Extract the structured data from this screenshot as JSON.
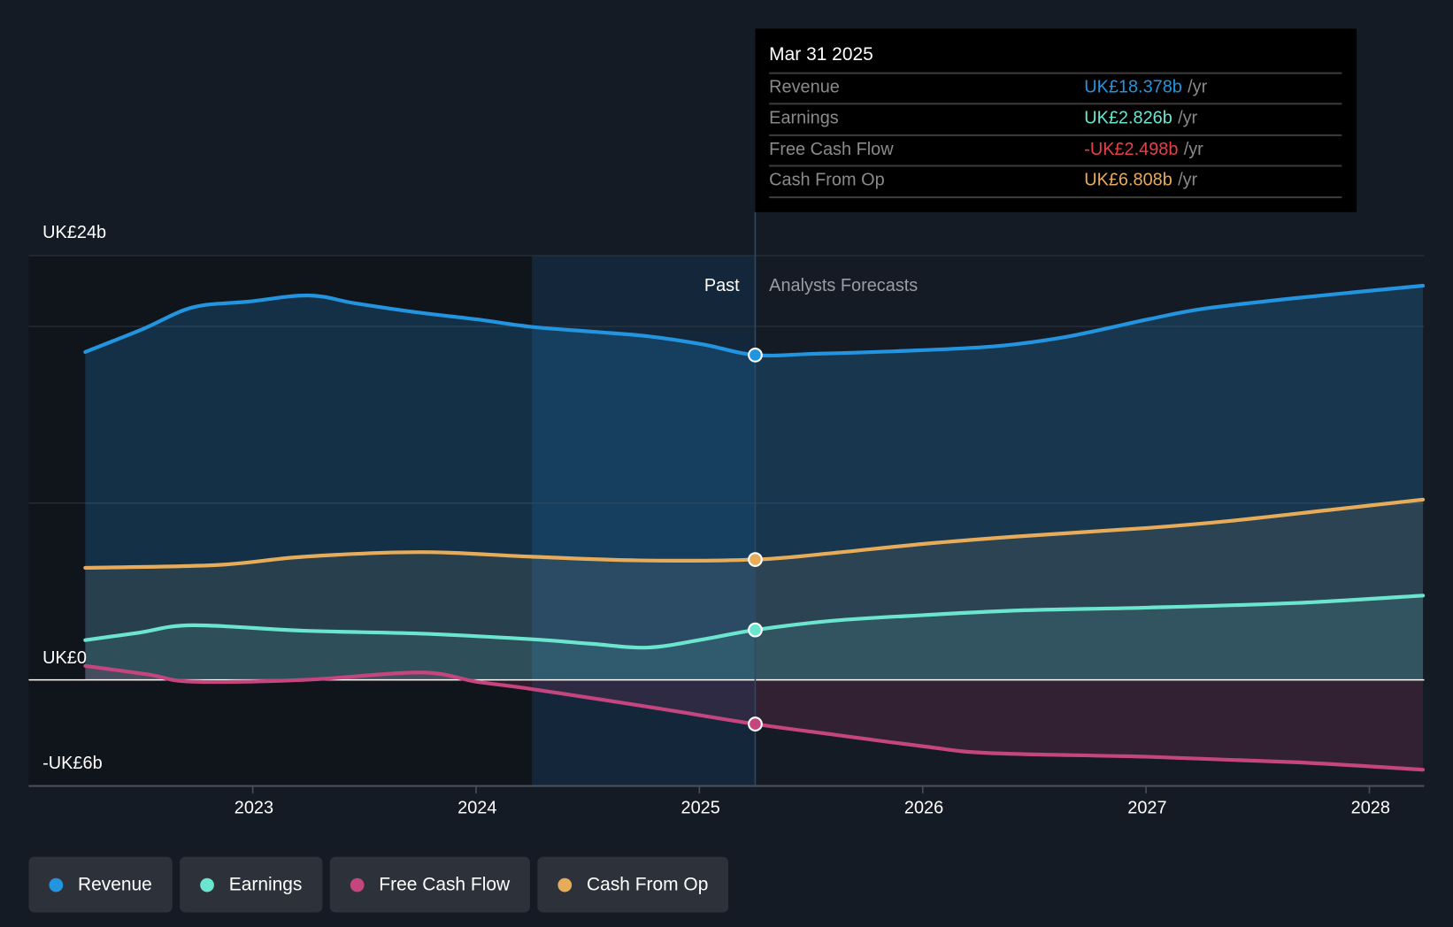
{
  "chart_data": {
    "type": "line",
    "title": "",
    "y_unit": "UKÂ£ billions",
    "ylim": [
      -6,
      24
    ],
    "y_ticks": [
      {
        "value": 24,
        "label": "UK£24b"
      },
      {
        "value": 0,
        "label": "UK£0"
      },
      {
        "value": -6,
        "label": "-UK£6b"
      }
    ],
    "y_gridlines": [
      24,
      20,
      10,
      0
    ],
    "xlim": [
      2022.0,
      2028.24
    ],
    "x_ticks": [
      {
        "value": 2023,
        "label": "2023"
      },
      {
        "value": 2024,
        "label": "2024"
      },
      {
        "value": 2025,
        "label": "2025"
      },
      {
        "value": 2026,
        "label": "2026"
      },
      {
        "value": 2027,
        "label": "2027"
      },
      {
        "value": 2028,
        "label": "2028"
      }
    ],
    "past_label": "Past",
    "forecast_label": "Analysts Forecasts",
    "divider_x": 2025.25,
    "highlight_start_x": 2024.25,
    "series": [
      {
        "name": "Revenue",
        "color": "#2394df",
        "points": [
          [
            2022.25,
            18.55
          ],
          [
            2022.51,
            19.86
          ],
          [
            2022.73,
            21.07
          ],
          [
            2022.98,
            21.4
          ],
          [
            2023.25,
            21.75
          ],
          [
            2023.46,
            21.3
          ],
          [
            2023.73,
            20.8
          ],
          [
            2024.0,
            20.4
          ],
          [
            2024.25,
            19.97
          ],
          [
            2024.52,
            19.7
          ],
          [
            2024.77,
            19.44
          ],
          [
            2025.02,
            18.97
          ],
          [
            2025.25,
            18.378
          ],
          [
            2025.52,
            18.45
          ],
          [
            2025.89,
            18.6
          ],
          [
            2026.32,
            18.87
          ],
          [
            2026.64,
            19.4
          ],
          [
            2027.01,
            20.4
          ],
          [
            2027.26,
            21.0
          ],
          [
            2027.67,
            21.6
          ],
          [
            2028.24,
            22.3
          ]
        ]
      },
      {
        "name": "Cash From Op",
        "color": "#e6ac5a",
        "points": [
          [
            2022.25,
            6.34
          ],
          [
            2022.84,
            6.5
          ],
          [
            2023.23,
            6.97
          ],
          [
            2023.75,
            7.23
          ],
          [
            2024.25,
            6.97
          ],
          [
            2024.73,
            6.76
          ],
          [
            2025.25,
            6.808
          ],
          [
            2025.6,
            7.18
          ],
          [
            2026.01,
            7.7
          ],
          [
            2026.43,
            8.12
          ],
          [
            2027.01,
            8.6
          ],
          [
            2027.38,
            9.0
          ],
          [
            2027.84,
            9.64
          ],
          [
            2028.24,
            10.2
          ]
        ]
      },
      {
        "name": "Earnings",
        "color": "#6ce5cf",
        "points": [
          [
            2022.25,
            2.25
          ],
          [
            2022.49,
            2.67
          ],
          [
            2022.73,
            3.09
          ],
          [
            2023.23,
            2.78
          ],
          [
            2023.75,
            2.62
          ],
          [
            2024.25,
            2.3
          ],
          [
            2024.52,
            2.04
          ],
          [
            2024.77,
            1.83
          ],
          [
            2025.02,
            2.3
          ],
          [
            2025.25,
            2.826
          ],
          [
            2025.6,
            3.35
          ],
          [
            2026.01,
            3.67
          ],
          [
            2026.43,
            3.93
          ],
          [
            2027.01,
            4.09
          ],
          [
            2027.67,
            4.35
          ],
          [
            2028.24,
            4.77
          ]
        ]
      },
      {
        "name": "Free Cash Flow",
        "color": "#c5457f",
        "points": [
          [
            2022.25,
            0.79
          ],
          [
            2022.53,
            0.31
          ],
          [
            2022.73,
            -0.1
          ],
          [
            2023.23,
            0.0
          ],
          [
            2023.75,
            0.42
          ],
          [
            2024.0,
            -0.1
          ],
          [
            2024.25,
            -0.52
          ],
          [
            2024.77,
            -1.52
          ],
          [
            2025.25,
            -2.498
          ],
          [
            2025.6,
            -3.09
          ],
          [
            2026.01,
            -3.77
          ],
          [
            2026.3,
            -4.14
          ],
          [
            2027.01,
            -4.35
          ],
          [
            2027.67,
            -4.66
          ],
          [
            2028.24,
            -5.08
          ]
        ]
      }
    ]
  },
  "tooltip": {
    "date": "Mar 31 2025",
    "unit": "/yr",
    "rows": [
      {
        "label": "Revenue",
        "value": "UK£18.378b",
        "color": "#2394df"
      },
      {
        "label": "Earnings",
        "value": "UK£2.826b",
        "color": "#6ce5cf"
      },
      {
        "label": "Free Cash Flow",
        "value": "-UK£2.498b",
        "color": "#e5414a"
      },
      {
        "label": "Cash From Op",
        "value": "UK£6.808b",
        "color": "#e6ac5a"
      }
    ]
  },
  "legend": [
    {
      "label": "Revenue",
      "color": "#2394df"
    },
    {
      "label": "Earnings",
      "color": "#6ce5cf"
    },
    {
      "label": "Free Cash Flow",
      "color": "#c5457f"
    },
    {
      "label": "Cash From Op",
      "color": "#e6ac5a"
    }
  ]
}
